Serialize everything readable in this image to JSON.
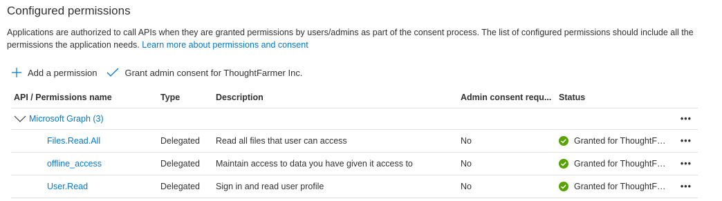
{
  "section": {
    "title": "Configured permissions",
    "intro_text": "Applications are authorized to call APIs when they are granted permissions by users/admins as part of the consent process. The list of configured permissions should include all the permissions the application needs.",
    "learn_more_link": "Learn more about permissions and consent"
  },
  "toolbar": {
    "add_label": "Add a permission",
    "grant_label": "Grant admin consent for ThoughtFarmer Inc."
  },
  "table": {
    "headers": {
      "api": "API / Permissions name",
      "type": "Type",
      "description": "Description",
      "admin": "Admin consent requ...",
      "status": "Status"
    },
    "group": {
      "label": "Microsoft Graph (3)",
      "more": "•••"
    },
    "rows": [
      {
        "name": "Files.Read.All",
        "type": "Delegated",
        "description": "Read all files that user can access",
        "admin": "No",
        "status": "Granted for ThoughtFarmer Inc.",
        "more": "•••"
      },
      {
        "name": "offline_access",
        "type": "Delegated",
        "description": "Maintain access to data you have given it access to",
        "admin": "No",
        "status": "Granted for ThoughtFarmer Inc.",
        "more": "•••"
      },
      {
        "name": "User.Read",
        "type": "Delegated",
        "description": "Sign in and read user profile",
        "admin": "No",
        "status": "Granted for ThoughtFarmer Inc.",
        "more": "•••"
      }
    ]
  },
  "icons": {
    "add": "plus-icon",
    "grant": "checkmark-icon",
    "group_toggle": "chevron-down-icon",
    "status": "green-check-circle-icon"
  },
  "colors": {
    "link": "#0078d4",
    "success": "#57a300",
    "text": "#323130",
    "border": "#e1dfdd"
  }
}
